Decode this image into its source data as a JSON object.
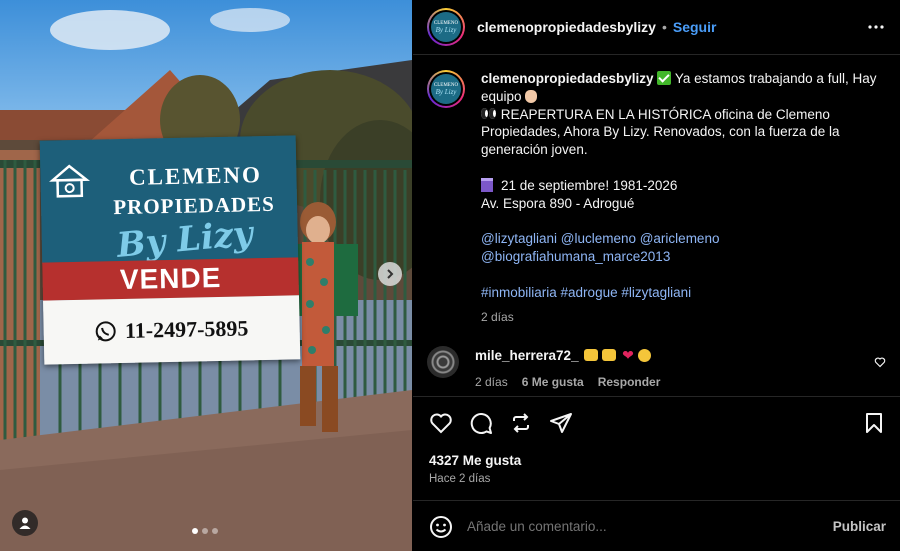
{
  "photo": {
    "sign": {
      "line1": "CLEMENO",
      "line2": "PROPIEDADES",
      "line3": "By Lizy",
      "action": "VENDE",
      "phone": "11-2497-5895"
    },
    "carousel_dots": 3,
    "active_dot": 0
  },
  "header": {
    "username": "clemenopropiedadesbylizy",
    "separator": "•",
    "follow_label": "Seguir",
    "more_icon": "more-horizontal-icon"
  },
  "caption": {
    "username": "clemenopropiedadesbylizy",
    "lines": {
      "l1": "Ya estamos trabajando a full, Hay",
      "l2": "equipo",
      "l3": "REAPERTURA EN LA HISTÓRICA oficina de Clemeno",
      "l4": "Propiedades, Ahora By Lizy. Renovados, con la fuerza de la",
      "l5": "generación joven.",
      "l6": "21 de septiembre! 1981-2026",
      "l7": "Av. Espora 890 - Adrogué"
    },
    "mentions1": "@lizytagliani @luclemeno @ariclemeno",
    "mentions2": "@biografiahumana_marce2013",
    "hashtags": "#inmobiliaria #adrogue #lizytagliani",
    "time": "2 días"
  },
  "comment": {
    "username": "mile_herrera72_",
    "time": "2 días",
    "likes": "6 Me gusta",
    "reply_label": "Responder"
  },
  "actions": {
    "likes_count": "4327 Me gusta",
    "posted_ago": "Hace 2 días",
    "comment_placeholder": "Añade un comentario...",
    "post_label": "Publicar"
  },
  "colors": {
    "accent_blue": "#4a9df8",
    "link_blue": "#8fb6f5",
    "sign_blue": "#1d5f7a",
    "sign_red": "#b6302e"
  }
}
